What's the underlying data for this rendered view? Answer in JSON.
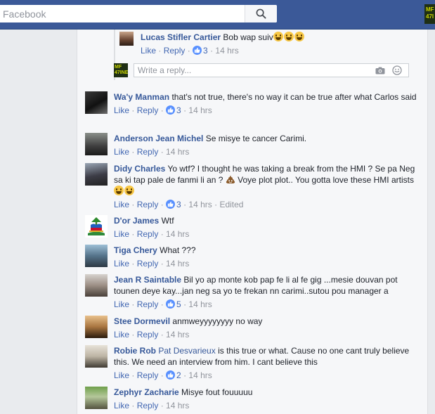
{
  "search": {
    "placeholder": "Facebook"
  },
  "top_avatar_text": "MF 47I",
  "reply_thread": {
    "comment": {
      "author": "Lucas Stifler Cartier",
      "text": "Bob wap suiv",
      "emoji_count": 3,
      "like": "Like",
      "reply": "Reply",
      "reactions": "3",
      "time": "14 hrs"
    },
    "reply_avatar_text": "MF 47INE",
    "reply_placeholder": "Write a reply..."
  },
  "comments": [
    {
      "author": "Wa'y Manman",
      "text": "that's not true, there's no way it can be true after what Carlos said",
      "like": "Like",
      "reply": "Reply",
      "reactions": "3",
      "time": "14 hrs"
    },
    {
      "author": "Anderson Jean Michel",
      "text": "Se misye te cancer Carimi.",
      "like": "Like",
      "reply": "Reply",
      "time": "14 hrs"
    },
    {
      "author": "Didy Charles",
      "text_a": "Yo wtf? I thought he was taking a break from the HMI ? Se pa Neg sa ki tap pale de fanmi li an ?",
      "text_b": "Voye plot plot.. You gotta love these HMI artists",
      "like": "Like",
      "reply": "Reply",
      "reactions": "3",
      "time": "14 hrs",
      "edited": "Edited"
    },
    {
      "author": "D'or James",
      "text": "Wtf",
      "like": "Like",
      "reply": "Reply",
      "time": "14 hrs"
    },
    {
      "author": "Tiga Chery",
      "text": "What ???",
      "like": "Like",
      "reply": "Reply",
      "time": "14 hrs"
    },
    {
      "author": "Jean R Saintable",
      "text": "Bil yo ap monte kob pap fe li al fe gig ...mesie douvan pot tounen deye kay...jan neg sa yo te frekan nn carimi..sutou pou manager a",
      "like": "Like",
      "reply": "Reply",
      "reactions": "5",
      "time": "14 hrs"
    },
    {
      "author": "Stee Dormevil",
      "text": "anmweyyyyyyyy no way",
      "like": "Like",
      "reply": "Reply",
      "time": "14 hrs"
    },
    {
      "author": "Robie Rob",
      "mention": "Pat Desvarieux",
      "text": "is this true or what. Cause no one cant truly believe this. We need an interview from him. I cant believe this",
      "like": "Like",
      "reply": "Reply",
      "reactions": "2",
      "time": "14 hrs"
    },
    {
      "author": "Zephyr Zacharie",
      "text": "Misye fout fouuuuu",
      "like": "Like",
      "reply": "Reply",
      "time": "14 hrs"
    }
  ],
  "colors": {
    "header": "#3b5998",
    "link": "#4267b2",
    "author": "#365899",
    "meta": "#90949c",
    "like_badge": "#5890ff"
  }
}
